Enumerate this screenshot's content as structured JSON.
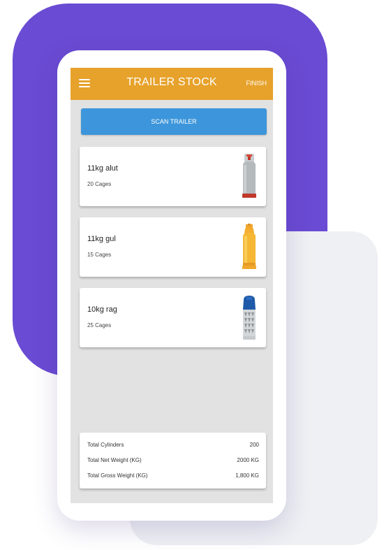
{
  "appbar": {
    "title": "TRAILER STOCK",
    "finish_label": "FINISH",
    "menu_icon": "hamburger-menu-icon",
    "color": "#e7a22b"
  },
  "scan_button": {
    "label": "SCAN TRAILER",
    "color": "#3d96db"
  },
  "items": [
    {
      "name": "11kg alut",
      "count": "20 Cages",
      "icon": "grey-gas-cylinder-icon"
    },
    {
      "name": "11kg gul",
      "count": "15 Cages",
      "icon": "yellow-gas-cylinder-icon"
    },
    {
      "name": "10kg rag",
      "count": "25 Cages",
      "icon": "blue-composite-gas-cylinder-icon"
    }
  ],
  "summary": {
    "rows": [
      {
        "label": "Total Cylinders",
        "value": "200"
      },
      {
        "label": "Total Net Weight (KG)",
        "value": "2000 KG"
      },
      {
        "label": "Total Gross Weight (KG)",
        "value": "1,800 KG"
      }
    ]
  },
  "colors": {
    "purple_bg": "#6a4bd3",
    "grey_bg": "#eef0f4",
    "screen_bg": "#e2e2e2"
  }
}
